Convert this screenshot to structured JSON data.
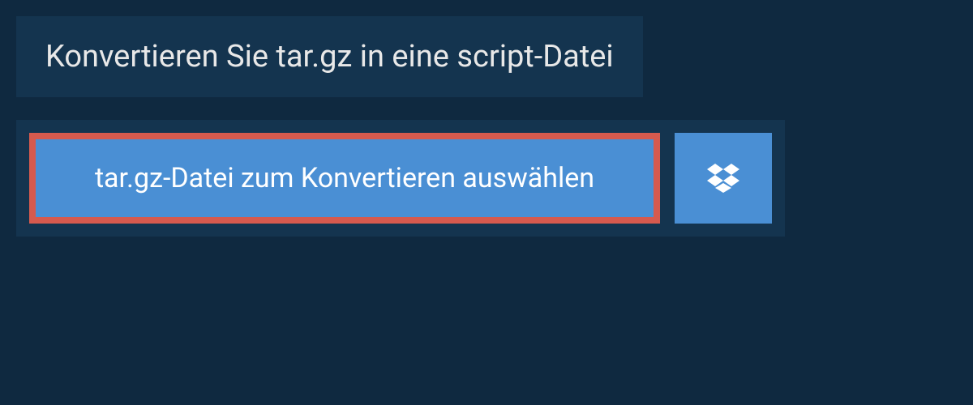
{
  "header": {
    "title": "Konvertieren Sie tar.gz in eine script-Datei"
  },
  "upload": {
    "select_button_label": "tar.gz-Datei zum Konvertieren auswählen",
    "dropbox_icon": "dropbox"
  },
  "colors": {
    "background": "#0f2940",
    "panel": "#14344f",
    "button": "#4a8fd4",
    "highlight_border": "#d65a4e",
    "text_light": "#e8e8e8",
    "text_white": "#ffffff"
  }
}
